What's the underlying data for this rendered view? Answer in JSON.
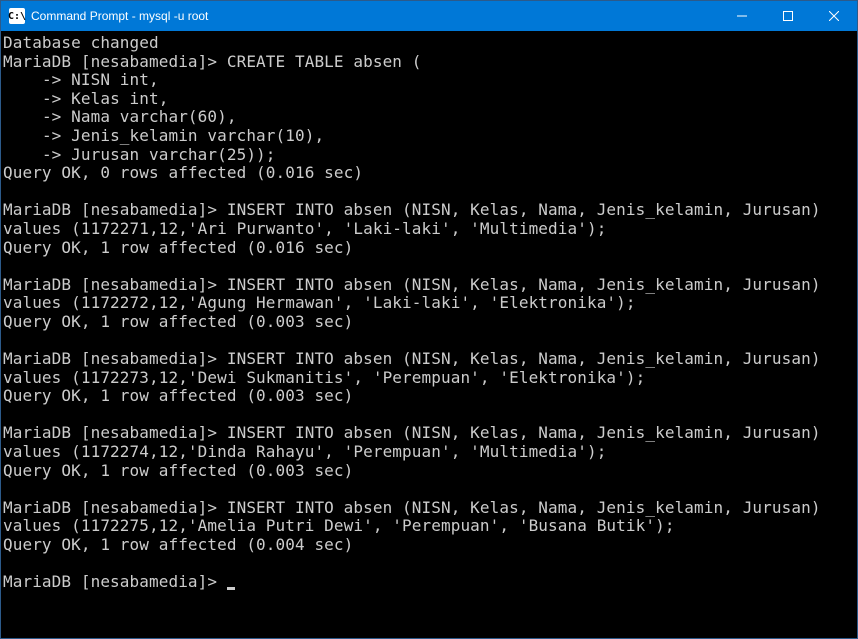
{
  "titlebar": {
    "icon_label": "C:\\",
    "title": "Command Prompt - mysql  -u root"
  },
  "terminal": {
    "lines": [
      "Database changed",
      "MariaDB [nesabamedia]> CREATE TABLE absen (",
      "    -> NISN int,",
      "    -> Kelas int,",
      "    -> Nama varchar(60),",
      "    -> Jenis_kelamin varchar(10),",
      "    -> Jurusan varchar(25));",
      "Query OK, 0 rows affected (0.016 sec)",
      "",
      "MariaDB [nesabamedia]> INSERT INTO absen (NISN, Kelas, Nama, Jenis_kelamin, Jurusan) values (1172271,12,'Ari Purwanto', 'Laki-laki', 'Multimedia');",
      "Query OK, 1 row affected (0.016 sec)",
      "",
      "MariaDB [nesabamedia]> INSERT INTO absen (NISN, Kelas, Nama, Jenis_kelamin, Jurusan) values (1172272,12,'Agung Hermawan', 'Laki-laki', 'Elektronika');",
      "Query OK, 1 row affected (0.003 sec)",
      "",
      "MariaDB [nesabamedia]> INSERT INTO absen (NISN, Kelas, Nama, Jenis_kelamin, Jurusan) values (1172273,12,'Dewi Sukmanitis', 'Perempuan', 'Elektronika');",
      "Query OK, 1 row affected (0.003 sec)",
      "",
      "MariaDB [nesabamedia]> INSERT INTO absen (NISN, Kelas, Nama, Jenis_kelamin, Jurusan) values (1172274,12,'Dinda Rahayu', 'Perempuan', 'Multimedia');",
      "Query OK, 1 row affected (0.003 sec)",
      "",
      "MariaDB [nesabamedia]> INSERT INTO absen (NISN, Kelas, Nama, Jenis_kelamin, Jurusan) values (1172275,12,'Amelia Putri Dewi', 'Perempuan', 'Busana Butik');",
      "Query OK, 1 row affected (0.004 sec)",
      ""
    ],
    "prompt": "MariaDB [nesabamedia]> "
  }
}
